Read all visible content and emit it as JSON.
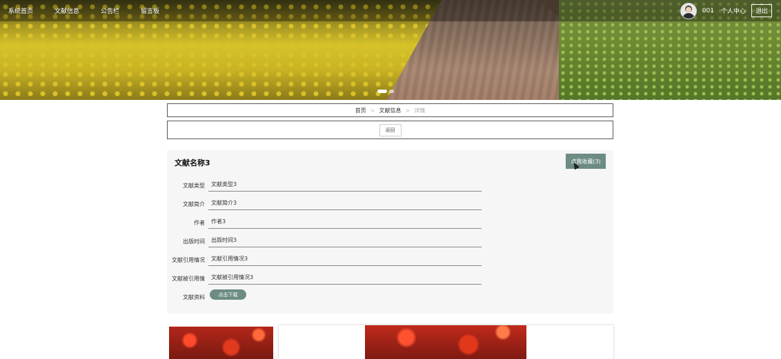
{
  "nav": {
    "items": [
      "系统首页",
      "文献信息",
      "公告栏",
      "留言板"
    ]
  },
  "user": {
    "name": "001",
    "center_label": "个人中心",
    "logout_label": "退出"
  },
  "breadcrumb": {
    "home": "首页",
    "section": "文献信息",
    "current": "详情",
    "separator": ">"
  },
  "back_label": "返回",
  "detail": {
    "title": "文献名称3",
    "favorite_label": "点我收藏(3)",
    "fields": [
      {
        "label": "文献类型",
        "value": "文献类型3"
      },
      {
        "label": "文献简介",
        "value": "文献简介3"
      },
      {
        "label": "作者",
        "value": "作者3"
      },
      {
        "label": "出版时间",
        "value": "出版时间3"
      },
      {
        "label": "文献引用情况",
        "value": "文献引用情况3"
      },
      {
        "label": "文献被引用情",
        "value": "文献被引用情况3"
      }
    ],
    "file_label": "文献资料",
    "download_label": "点击下载"
  },
  "carousel": {
    "slide_count": 2,
    "active_index": 0
  },
  "colors": {
    "accent": "#6c8c84"
  }
}
